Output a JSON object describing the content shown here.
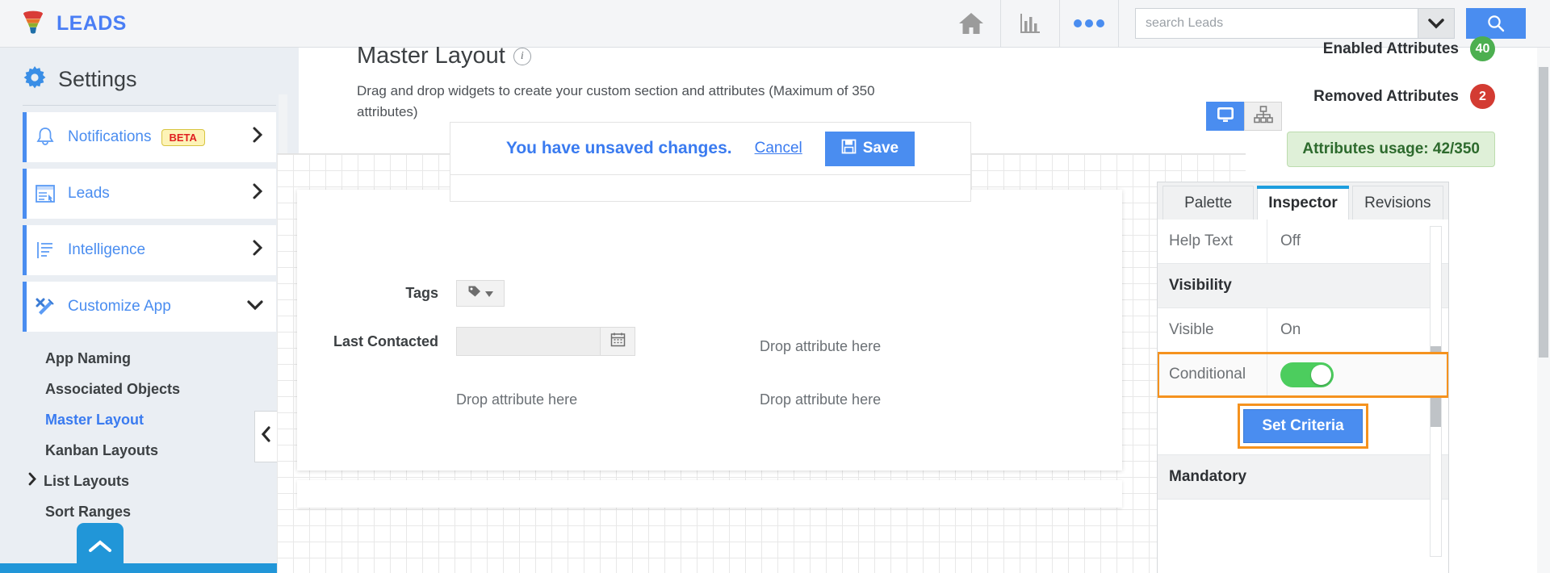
{
  "topbar": {
    "brand": "LEADS",
    "logo_icon": "funnel-icon",
    "home_icon": "home-icon",
    "reports_icon": "bar-chart-icon",
    "more_icon": "more-dots-icon",
    "search": {
      "placeholder": "search Leads",
      "value": ""
    },
    "search_caret_icon": "chevron-down-icon",
    "search_button_icon": "search-icon"
  },
  "sidebar": {
    "title": "Settings",
    "gear_icon": "gear-icon",
    "items": [
      {
        "label": "Notifications",
        "icon": "bell-icon",
        "badge": "BETA",
        "chevron": "›"
      },
      {
        "label": "Leads",
        "icon": "window-list-icon",
        "chevron": "›"
      },
      {
        "label": "Intelligence",
        "icon": "document-lines-icon",
        "chevron": "›"
      },
      {
        "label": "Customize App",
        "icon": "tools-icon",
        "chevron": "⌄"
      }
    ],
    "subitems": [
      {
        "label": "App Naming",
        "active": false,
        "expandable": false
      },
      {
        "label": "Associated Objects",
        "active": false,
        "expandable": false
      },
      {
        "label": "Master Layout",
        "active": true,
        "expandable": false
      },
      {
        "label": "Kanban Layouts",
        "active": false,
        "expandable": false
      },
      {
        "label": "List Layouts",
        "active": false,
        "expandable": true,
        "chevron": "›"
      },
      {
        "label": "Sort Ranges",
        "active": false,
        "expandable": false
      }
    ],
    "scroll_top_icon": "chevron-up-icon"
  },
  "page": {
    "title": "Master Layout",
    "info_icon": "info-icon",
    "subtitle": "Drag and drop widgets to create your custom section and attributes (Maximum of 350 attributes)"
  },
  "attributes": {
    "enabled_label": "Enabled Attributes",
    "enabled_count": "40",
    "removed_label": "Removed Attributes",
    "removed_count": "2",
    "usage_text": "Attributes usage: 42/350"
  },
  "unsaved": {
    "message": "You have unsaved changes.",
    "cancel_label": "Cancel",
    "save_label": "Save",
    "save_icon": "floppy-disk-icon"
  },
  "device_toggle": {
    "desktop_icon": "monitor-icon",
    "hierarchy_icon": "sitemap-icon",
    "active": "desktop"
  },
  "canvas": {
    "collapse_icon": "chevron-left-icon",
    "fields": [
      {
        "label": "Tags",
        "control": "tag-dropdown",
        "icon": "tag-icon",
        "caret": "caret-down-icon"
      },
      {
        "label": "Last Contacted",
        "control": "date-input",
        "value": "",
        "icon": "calendar-icon"
      }
    ],
    "drop_hints": [
      "Drop attribute here",
      "Drop attribute here",
      "Drop attribute here"
    ]
  },
  "inspector": {
    "tabs": [
      {
        "label": "Palette",
        "active": false
      },
      {
        "label": "Inspector",
        "active": true
      },
      {
        "label": "Revisions",
        "active": false
      }
    ],
    "rows": [
      {
        "type": "pair",
        "key": "Help Text",
        "value": "Off"
      },
      {
        "type": "section",
        "key": "Visibility"
      },
      {
        "type": "pair",
        "key": "Visible",
        "value": "On"
      },
      {
        "type": "toggle",
        "key": "Conditional",
        "toggle_state": "on",
        "highlighted": true
      },
      {
        "type": "button",
        "label": "Set Criteria",
        "highlighted": true
      },
      {
        "type": "section",
        "key": "Mandatory"
      }
    ]
  },
  "colors": {
    "accent_blue": "#4a8df0",
    "brand_blue": "#4a7ef5",
    "highlight_orange": "#f5921e",
    "toggle_green": "#4ccd5e",
    "badge_green": "#4caf50",
    "badge_red": "#d33b32",
    "tab_active_underline": "#1e9ede"
  }
}
